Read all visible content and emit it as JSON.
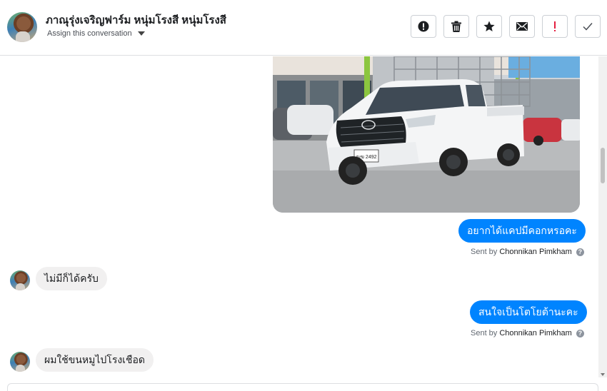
{
  "header": {
    "name": "ภาณุรุ่งเจริญฟาร์ม หนุ่มโรงสี หนุ่มโรงสี",
    "assign_label": "Assign this conversation",
    "actions": [
      {
        "name": "spam-button",
        "icon": "exclamation-circle-icon"
      },
      {
        "name": "delete-button",
        "icon": "trash-icon"
      },
      {
        "name": "star-button",
        "icon": "star-icon"
      },
      {
        "name": "mark-unread-button",
        "icon": "envelope-icon"
      },
      {
        "name": "follow-up-button",
        "icon": "red-exclamation-icon"
      },
      {
        "name": "mark-done-button",
        "icon": "checkmark-icon"
      }
    ]
  },
  "thread": {
    "image_message": {
      "description": "white pickup truck"
    },
    "messages": [
      {
        "direction": "out",
        "text": "อยากได้แคปมีคอกหรอคะ",
        "sent_by_prefix": "Sent by",
        "sent_by_name": "Chonnikan Pimkham"
      },
      {
        "direction": "in",
        "text": "ไม่มีก็ได้ครับ"
      },
      {
        "direction": "out",
        "text": "สนใจเป็นโตโยต้านะคะ",
        "sent_by_prefix": "Sent by",
        "sent_by_name": "Chonnikan Pimkham"
      },
      {
        "direction": "in",
        "text": "ผมใช้ขนหมูไปโรงเชือด"
      }
    ]
  },
  "plate_text": "ฒฆ 2492",
  "colors": {
    "accent": "#0084ff",
    "incoming_bubble": "#f1f0f0",
    "follow_up_red": "#e41e3f"
  }
}
